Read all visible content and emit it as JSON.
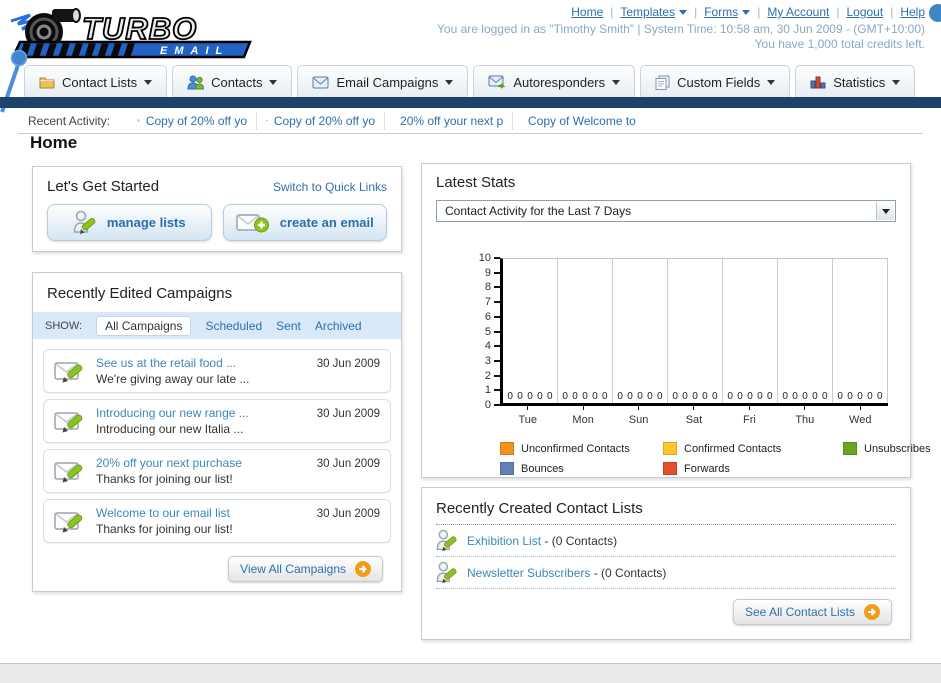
{
  "header": {
    "separator": "|",
    "links": [
      {
        "label": "Home",
        "dropdown": false
      },
      {
        "label": "Templates",
        "dropdown": true
      },
      {
        "label": "Forms",
        "dropdown": true
      },
      {
        "label": "My Account",
        "dropdown": false
      },
      {
        "label": "Logout",
        "dropdown": false
      },
      {
        "label": "Help",
        "dropdown": false
      }
    ],
    "status_line1": "You are logged in as \"Timothy Smith\" | System Time: 10:58 am, 30 Jun 2009 - (GMT+10:00)",
    "status_line2": "You have 1,000 total credits left.",
    "logo_line1": "TURBO",
    "logo_line2": "EMAIL"
  },
  "nav": {
    "tabs": [
      {
        "label": "Contact Lists",
        "icon": "folder-icon"
      },
      {
        "label": "Contacts",
        "icon": "people-icon"
      },
      {
        "label": "Email Campaigns",
        "icon": "envelope-icon"
      },
      {
        "label": "Autoresponders",
        "icon": "envelope-arrow-icon"
      },
      {
        "label": "Custom Fields",
        "icon": "pages-icon"
      },
      {
        "label": "Statistics",
        "icon": "bar-chart-icon"
      }
    ]
  },
  "recent_activity": {
    "label": "Recent Activity:",
    "items": [
      {
        "text": "Copy of 20% off yo"
      },
      {
        "text": "Copy of 20% off yo"
      },
      {
        "text": "20% off your next p"
      },
      {
        "text": "Copy of Welcome to"
      }
    ]
  },
  "page_title": "Home",
  "get_started": {
    "title": "Let's Get Started",
    "switch_link": "Switch to Quick Links",
    "manage_lists_label": "manage lists",
    "create_email_label": "create an email"
  },
  "campaigns": {
    "title": "Recently Edited Campaigns",
    "show_label": "SHOW:",
    "filters": [
      "All Campaigns",
      "Scheduled",
      "Sent",
      "Archived"
    ],
    "active_filter": "All Campaigns",
    "items": [
      {
        "title": "See us at the retail food ...",
        "subtitle": "We're giving away our late ...",
        "date": "30 Jun 2009"
      },
      {
        "title": "Introducing our new range ...",
        "subtitle": "Introducing our new Italia ...",
        "date": "30 Jun 2009"
      },
      {
        "title": "20% off your next purchase",
        "subtitle": "Thanks for joining our list!",
        "date": "30 Jun 2009"
      },
      {
        "title": "Welcome to our email list",
        "subtitle": "Thanks for joining our list!",
        "date": "30 Jun 2009"
      }
    ],
    "view_all_label": "View All Campaigns"
  },
  "stats": {
    "title": "Latest Stats",
    "selector_value": "Contact Activity for the Last 7 Days"
  },
  "chart_data": {
    "type": "bar",
    "title": "Contact Activity for the Last 7 Days",
    "categories": [
      "Tue",
      "Mon",
      "Sun",
      "Sat",
      "Fri",
      "Thu",
      "Wed"
    ],
    "series": [
      {
        "name": "Unconfirmed Contacts",
        "color": "#f2921f",
        "values": [
          0,
          0,
          0,
          0,
          0,
          0,
          0
        ]
      },
      {
        "name": "Confirmed Contacts",
        "color": "#fdc62e",
        "values": [
          0,
          0,
          0,
          0,
          0,
          0,
          0
        ]
      },
      {
        "name": "Unsubscribes",
        "color": "#69a520",
        "values": [
          0,
          0,
          0,
          0,
          0,
          0,
          0
        ]
      },
      {
        "name": "Bounces",
        "color": "#6480b5",
        "values": [
          0,
          0,
          0,
          0,
          0,
          0,
          0
        ]
      },
      {
        "name": "Forwards",
        "color": "#e54e2a",
        "values": [
          0,
          0,
          0,
          0,
          0,
          0,
          0
        ]
      }
    ],
    "ylim": [
      0,
      10
    ],
    "y_ticks": [
      0,
      1,
      2,
      3,
      4,
      5,
      6,
      7,
      8,
      9,
      10
    ],
    "show_value_labels": true,
    "grid": true,
    "legend_position": "bottom"
  },
  "contact_lists": {
    "title": "Recently Created Contact Lists",
    "items": [
      {
        "name": "Exhibition List",
        "suffix": " - (0 Contacts)"
      },
      {
        "name": "Newsletter Subscribers",
        "suffix": " - (0 Contacts)"
      }
    ],
    "see_all_label": "See All Contact Lists"
  },
  "colors": {
    "navy_bar": "#1a4469",
    "link_blue": "#2d6fae",
    "campaign_link": "#3f86ba",
    "filter_bar_bg": "#d9e9f9",
    "status_text": "#87a9c6",
    "button_arrow_circle": "#f09d1c"
  }
}
